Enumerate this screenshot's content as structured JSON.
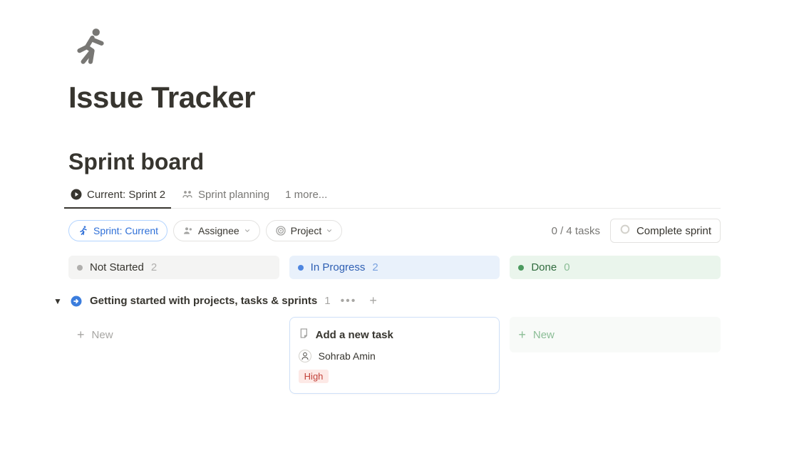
{
  "page": {
    "title": "Issue Tracker",
    "section": "Sprint board"
  },
  "tabs": {
    "active": "Current: Sprint 2",
    "planning": "Sprint planning",
    "more": "1 more..."
  },
  "filters": {
    "sprint": "Sprint: Current",
    "assignee": "Assignee",
    "project": "Project"
  },
  "stats": {
    "count": "0 / 4 tasks",
    "complete_btn": "Complete sprint"
  },
  "columns": {
    "not_started": {
      "label": "Not Started",
      "count": "2"
    },
    "in_progress": {
      "label": "In Progress",
      "count": "2"
    },
    "done": {
      "label": "Done",
      "count": "0"
    }
  },
  "group": {
    "title": "Getting started with projects, tasks & sprints",
    "count": "1"
  },
  "new_label": "New",
  "card": {
    "title": "Add a new task",
    "assignee": "Sohrab Amin",
    "priority": "High"
  }
}
